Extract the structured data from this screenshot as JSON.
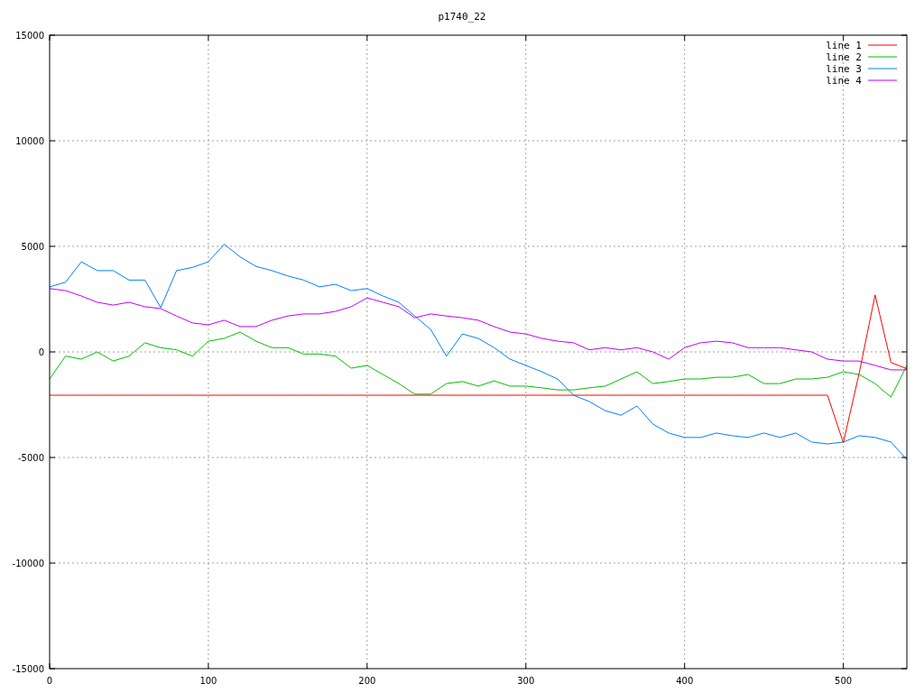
{
  "chart_data": {
    "type": "line",
    "title": "p1740_22",
    "x": [
      0,
      10,
      20,
      30,
      40,
      50,
      60,
      70,
      80,
      90,
      100,
      110,
      120,
      130,
      140,
      150,
      160,
      170,
      180,
      190,
      200,
      210,
      220,
      230,
      240,
      250,
      260,
      270,
      280,
      290,
      300,
      310,
      320,
      330,
      340,
      350,
      360,
      370,
      380,
      390,
      400,
      410,
      420,
      430,
      440,
      450,
      460,
      470,
      480,
      490,
      500,
      510,
      520,
      530,
      540
    ],
    "series": [
      {
        "name": "line 1",
        "color": "#ff0000",
        "values": [
          -2050,
          -2050,
          -2050,
          -2050,
          -2050,
          -2050,
          -2050,
          -2050,
          -2050,
          -2050,
          -2050,
          -2050,
          -2050,
          -2050,
          -2050,
          -2050,
          -2050,
          -2050,
          -2050,
          -2050,
          -2050,
          -2050,
          -2050,
          -2050,
          -2050,
          -2050,
          -2050,
          -2050,
          -2050,
          -2050,
          -2050,
          -2050,
          -2050,
          -2050,
          -2050,
          -2050,
          -2050,
          -2050,
          -2050,
          -2050,
          -2050,
          -2050,
          -2050,
          -2050,
          -2050,
          -2050,
          -2050,
          -2050,
          -2050,
          -2050,
          -4300,
          -1000,
          2700,
          -500,
          -800
        ]
      },
      {
        "name": "line 2",
        "color": "#00c000",
        "values": [
          -1280,
          -200,
          -340,
          0,
          -430,
          -200,
          430,
          200,
          100,
          -200,
          510,
          640,
          940,
          510,
          200,
          200,
          -100,
          -100,
          -200,
          -770,
          -640,
          -1070,
          -1500,
          -2000,
          -2000,
          -1500,
          -1400,
          -1620,
          -1370,
          -1620,
          -1620,
          -1700,
          -1800,
          -1800,
          -1700,
          -1620,
          -1280,
          -940,
          -1500,
          -1400,
          -1280,
          -1280,
          -1200,
          -1200,
          -1070,
          -1500,
          -1500,
          -1280,
          -1280,
          -1200,
          -940,
          -1070,
          -1500,
          -2140,
          -640
        ]
      },
      {
        "name": "line 3",
        "color": "#0080ff",
        "values": [
          3080,
          3300,
          4270,
          3850,
          3850,
          3400,
          3400,
          2100,
          3850,
          4000,
          4270,
          5100,
          4500,
          4050,
          3850,
          3600,
          3400,
          3080,
          3200,
          2900,
          3000,
          2650,
          2350,
          1700,
          1070,
          -200,
          850,
          640,
          200,
          -340,
          -640,
          -940,
          -1280,
          -2050,
          -2350,
          -2780,
          -3000,
          -2560,
          -3420,
          -3840,
          -4050,
          -4050,
          -3840,
          -3970,
          -4050,
          -3840,
          -4050,
          -3840,
          -4270,
          -4360,
          -4270,
          -3970,
          -4050,
          -4270,
          -5100
        ]
      },
      {
        "name": "line 4",
        "color": "#c000ff",
        "values": [
          3000,
          2900,
          2650,
          2350,
          2220,
          2350,
          2140,
          2050,
          1700,
          1370,
          1280,
          1500,
          1200,
          1200,
          1500,
          1700,
          1800,
          1800,
          1920,
          2140,
          2560,
          2350,
          2140,
          1620,
          1800,
          1700,
          1620,
          1500,
          1200,
          940,
          850,
          640,
          510,
          430,
          100,
          200,
          100,
          200,
          0,
          -340,
          200,
          430,
          510,
          430,
          200,
          200,
          200,
          100,
          0,
          -340,
          -430,
          -430,
          -640,
          -850,
          -850
        ]
      }
    ],
    "xlim": [
      0,
      540
    ],
    "ylim": [
      -15000,
      15000
    ],
    "xticks": [
      0,
      100,
      200,
      300,
      400,
      500
    ],
    "yticks": [
      -15000,
      -10000,
      -5000,
      0,
      5000,
      10000,
      15000
    ],
    "grid": true,
    "legend": true
  }
}
